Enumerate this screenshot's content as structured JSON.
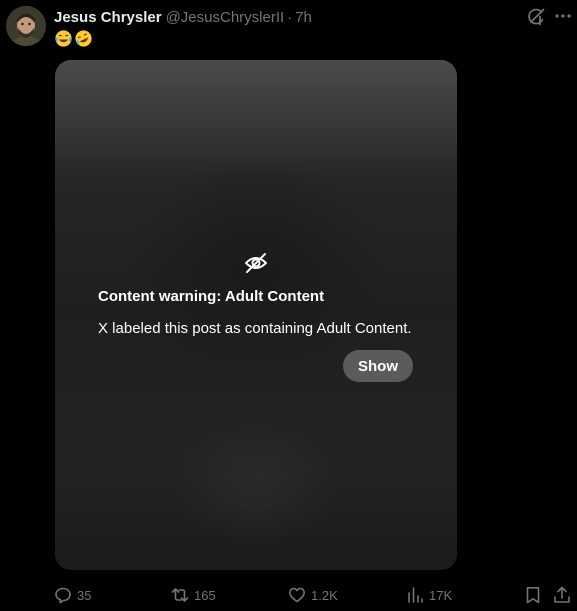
{
  "post": {
    "author_name": "Jesus Chrysler",
    "author_handle": "@JesusChryslerII",
    "separator": "·",
    "timestamp": "7h",
    "text_emojis": [
      "😂",
      "🤣"
    ]
  },
  "content_warning": {
    "icon": "eye-slash-icon",
    "title": "Content warning: Adult Content",
    "description": "X labeled this post as containing Adult Content.",
    "show_label": "Show"
  },
  "actions": {
    "replies": "35",
    "reposts": "165",
    "likes": "1.2K",
    "views": "17K"
  },
  "header_icons": [
    "grok-icon",
    "more-icon"
  ],
  "colors": {
    "background": "#000000",
    "text_primary": "#e7e9ea",
    "text_secondary": "#71767b",
    "show_button": "#5b5b5b"
  }
}
